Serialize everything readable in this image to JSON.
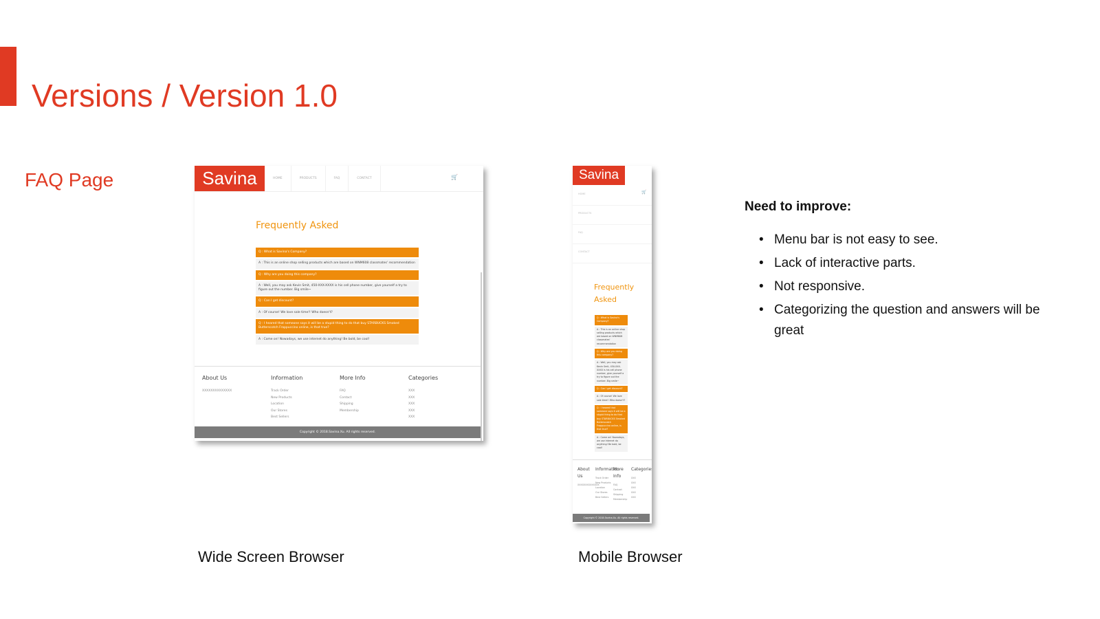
{
  "slide": {
    "title": "Versions / Version 1.0",
    "section": "FAQ Page",
    "captions": {
      "wide": "Wide Screen Browser",
      "mobile": "Mobile Browser"
    }
  },
  "notes": {
    "heading": "Need to improve:",
    "items": [
      "Menu bar is not easy to see.",
      "Lack of interactive parts.",
      "Not responsive.",
      "Categorizing the question and answers will be great"
    ]
  },
  "site": {
    "logo": "Savina",
    "nav": [
      "HOME",
      "PRODUCTS",
      "FAQ",
      "CONTACT"
    ],
    "cart_icon": "shopping-cart-icon",
    "faq_title_wide": "Frequently Asked",
    "faq_title_mobile": [
      "Frequently",
      "Asked"
    ],
    "faq": [
      {
        "q": "Q : What is Savina's Company?",
        "a": "A : This is an online shop selling products which are based on WNM608 classmates' recommendation"
      },
      {
        "q": "Q : Why are you doing this company?",
        "a": "A : Well, you may ask Kevin Smit, 450-XXX-XXXX is his cell phone number, give yourself a try to figure out the number. Big smile~"
      },
      {
        "q": "Q : Can I get discount?",
        "a": "A : Of course! We love sale time!! Who doesn't?"
      },
      {
        "q": "Q : I heared that someone says it will be a stupid thing to do that buy STARBUCKS Smoked Butterscotch Frappuccino online, is that true?",
        "a": "A : Come on! Nowadays, we use internet do anything! Be bold, be cool!"
      }
    ],
    "footer": {
      "about": {
        "title": "About Us",
        "items": [
          "XXXXXXXXXXXXXX"
        ]
      },
      "information": {
        "title": "Information",
        "items": [
          "Track Order",
          "New Products",
          "Location",
          "Our Stores",
          "Best Sellers"
        ]
      },
      "more_info": {
        "title": "More Info",
        "items": [
          "FAQ",
          "Contact",
          "Shipping",
          "Membership"
        ]
      },
      "categories": {
        "title": "Categories",
        "items": [
          "XXX",
          "XXX",
          "XXX",
          "XXX",
          "XXX"
        ]
      }
    },
    "copyright": "Copyright © 2018.Savina.Xu. All rights reserved."
  },
  "colors": {
    "accent": "#e03a23",
    "faq_orange": "#ee8b0b",
    "footer_gray": "#7b7b7b"
  }
}
